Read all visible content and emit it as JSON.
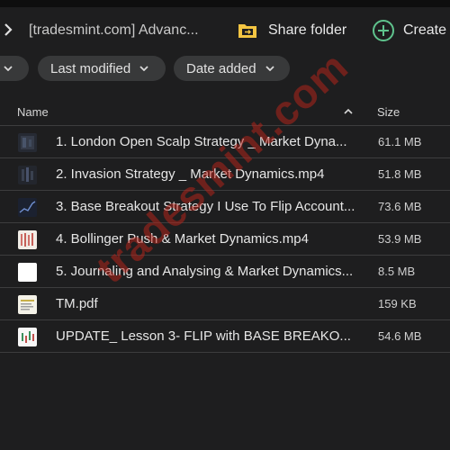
{
  "header": {
    "breadcrumb": "[tradesmint.com] Advanc...",
    "share_label": "Share folder",
    "create_label": "Create t"
  },
  "filters": {
    "last_modified": "Last modified",
    "date_added": "Date added"
  },
  "columns": {
    "name": "Name",
    "size": "Size"
  },
  "files": [
    {
      "name": "1. London Open Scalp Strategy _ Market Dyna...",
      "size": "61.1 MB",
      "thumb": "video-dark"
    },
    {
      "name": "2. Invasion Strategy _ Market Dynamics.mp4",
      "size": "51.8 MB",
      "thumb": "video-dark"
    },
    {
      "name": "3. Base Breakout Strategy I Use To Flip Account...",
      "size": "73.6 MB",
      "thumb": "video-chart"
    },
    {
      "name": "4. Bollinger Push & Market Dynamics.mp4",
      "size": "53.9 MB",
      "thumb": "video-candles"
    },
    {
      "name": "5. Journaling and Analysing & Market Dynamics...",
      "size": "8.5 MB",
      "thumb": "blank"
    },
    {
      "name": "TM.pdf",
      "size": "159 KB",
      "thumb": "pdf"
    },
    {
      "name": "UPDATE_ Lesson 3- FLIP with BASE BREAKO...",
      "size": "54.6 MB",
      "thumb": "chart-light"
    }
  ],
  "watermark": "tradesmint.com",
  "colors": {
    "accent_green": "#5fc38d",
    "folder_yellow": "#f4c542",
    "background": "#1e1e1f",
    "watermark": "#be2319"
  }
}
